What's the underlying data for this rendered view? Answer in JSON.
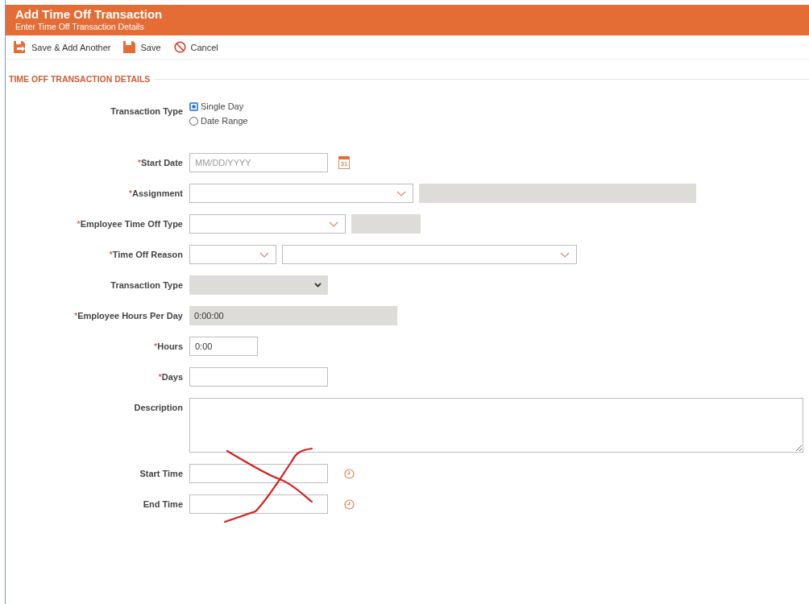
{
  "header": {
    "title": "Add Time Off Transaction",
    "subtitle": "Enter Time Off Transaction Details"
  },
  "toolbar": [
    {
      "kind": "save-add",
      "label": "Save & Add Another"
    },
    {
      "kind": "save",
      "label": "Save"
    },
    {
      "kind": "cancel",
      "label": "Cancel"
    }
  ],
  "section": {
    "title": "TIME OFF TRANSACTION DETAILS"
  },
  "fields": [
    {
      "label": "Transaction Type",
      "controls": [
        {
          "kind": "radio",
          "options": [
            {
              "label": "Single Day",
              "selected": true
            },
            {
              "label": "Date Range",
              "selected": false
            }
          ]
        }
      ]
    },
    {
      "required_mark": "*",
      "label": "Start Date",
      "controls": [
        {
          "kind": "text",
          "placeholder": "MM/DD/YYYY"
        },
        {
          "kind": "calendar",
          "day": "31"
        }
      ]
    },
    {
      "required_mark": "*",
      "label": "Assignment",
      "controls": [
        {
          "kind": "select"
        },
        {
          "kind": "readonly"
        }
      ]
    },
    {
      "required_mark": "*",
      "label": "Employee Time Off Type",
      "controls": [
        {
          "kind": "select"
        },
        {
          "kind": "readonly"
        }
      ]
    },
    {
      "required_mark": "*",
      "label": "Time Off Reason",
      "controls": [
        {
          "kind": "select"
        },
        {
          "kind": "select"
        }
      ]
    },
    {
      "label": "Transaction Type",
      "controls": [
        {
          "kind": "readonly-select"
        }
      ]
    },
    {
      "required_mark": "*",
      "label": "Employee Hours Per Day",
      "controls": [
        {
          "kind": "readonly",
          "value": "0:00:00"
        }
      ]
    },
    {
      "required_mark": "*",
      "label": "Hours",
      "controls": [
        {
          "kind": "text",
          "value": "0:00"
        }
      ]
    },
    {
      "required_mark": "*",
      "label": "Days",
      "controls": [
        {
          "kind": "text"
        }
      ]
    },
    {
      "label": "Description",
      "controls": [
        {
          "kind": "textarea"
        }
      ]
    },
    {
      "label": "Start Time",
      "controls": [
        {
          "kind": "text"
        },
        {
          "kind": "clock"
        }
      ]
    },
    {
      "label": "End Time",
      "controls": [
        {
          "kind": "text"
        },
        {
          "kind": "clock"
        }
      ]
    }
  ],
  "annotation": {
    "kind": "cross-out"
  }
}
